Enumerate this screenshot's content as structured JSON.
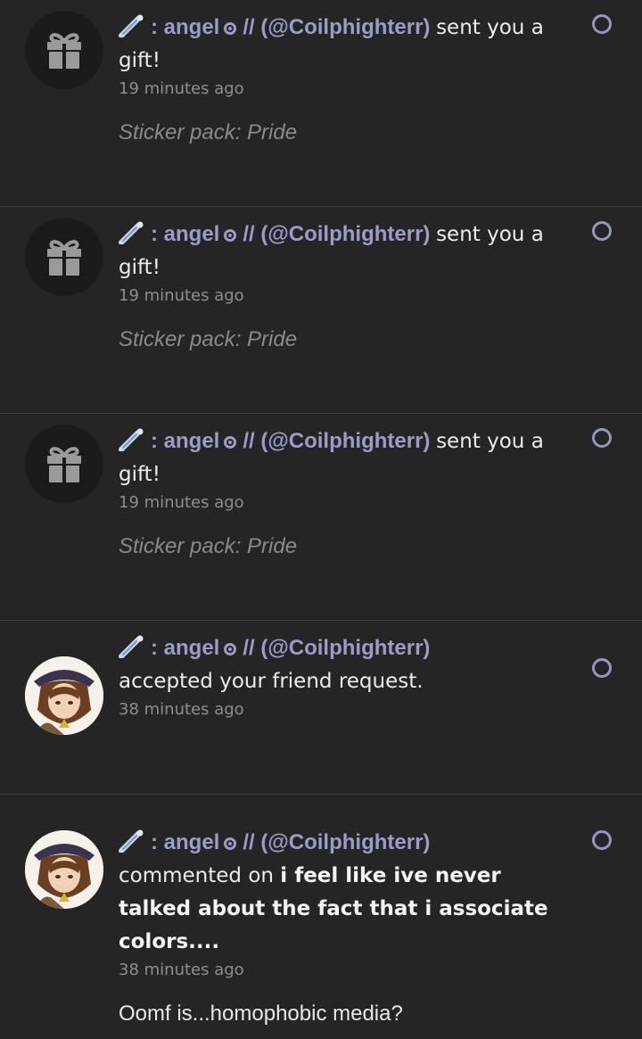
{
  "notifications": [
    {
      "type": "gift",
      "user": ": angel",
      "handle": "(@Coilphighterr)",
      "action": "sent you a gift!",
      "time": "19 minutes ago",
      "detail": "Sticker pack: Pride",
      "avatar_icon": "gift-icon"
    },
    {
      "type": "gift",
      "user": ": angel",
      "handle": "(@Coilphighterr)",
      "action": "sent you a gift!",
      "time": "19 minutes ago",
      "detail": "Sticker pack: Pride",
      "avatar_icon": "gift-icon"
    },
    {
      "type": "gift",
      "user": ": angel",
      "handle": "(@Coilphighterr)",
      "action": "sent you a gift!",
      "time": "19 minutes ago",
      "detail": "Sticker pack: Pride",
      "avatar_icon": "gift-icon"
    },
    {
      "type": "friend",
      "user": ": angel",
      "handle": "(@Coilphighterr)",
      "action": "accepted your friend request.",
      "time": "38 minutes ago",
      "avatar_icon": "user-avatar"
    },
    {
      "type": "comment",
      "user": ": angel",
      "handle": "(@Coilphighterr)",
      "action": "commented on",
      "post_title": "i feel like ive never talked about the fact that i associate colors....",
      "time": "38 minutes ago",
      "detail": "Oomf is...homophobic media?",
      "avatar_icon": "user-avatar"
    }
  ],
  "separator": "//",
  "colors": {
    "background": "#252526",
    "username": "#9a9cc9",
    "unread_dot": "#9395c2",
    "divider": "#3c3c3e"
  }
}
